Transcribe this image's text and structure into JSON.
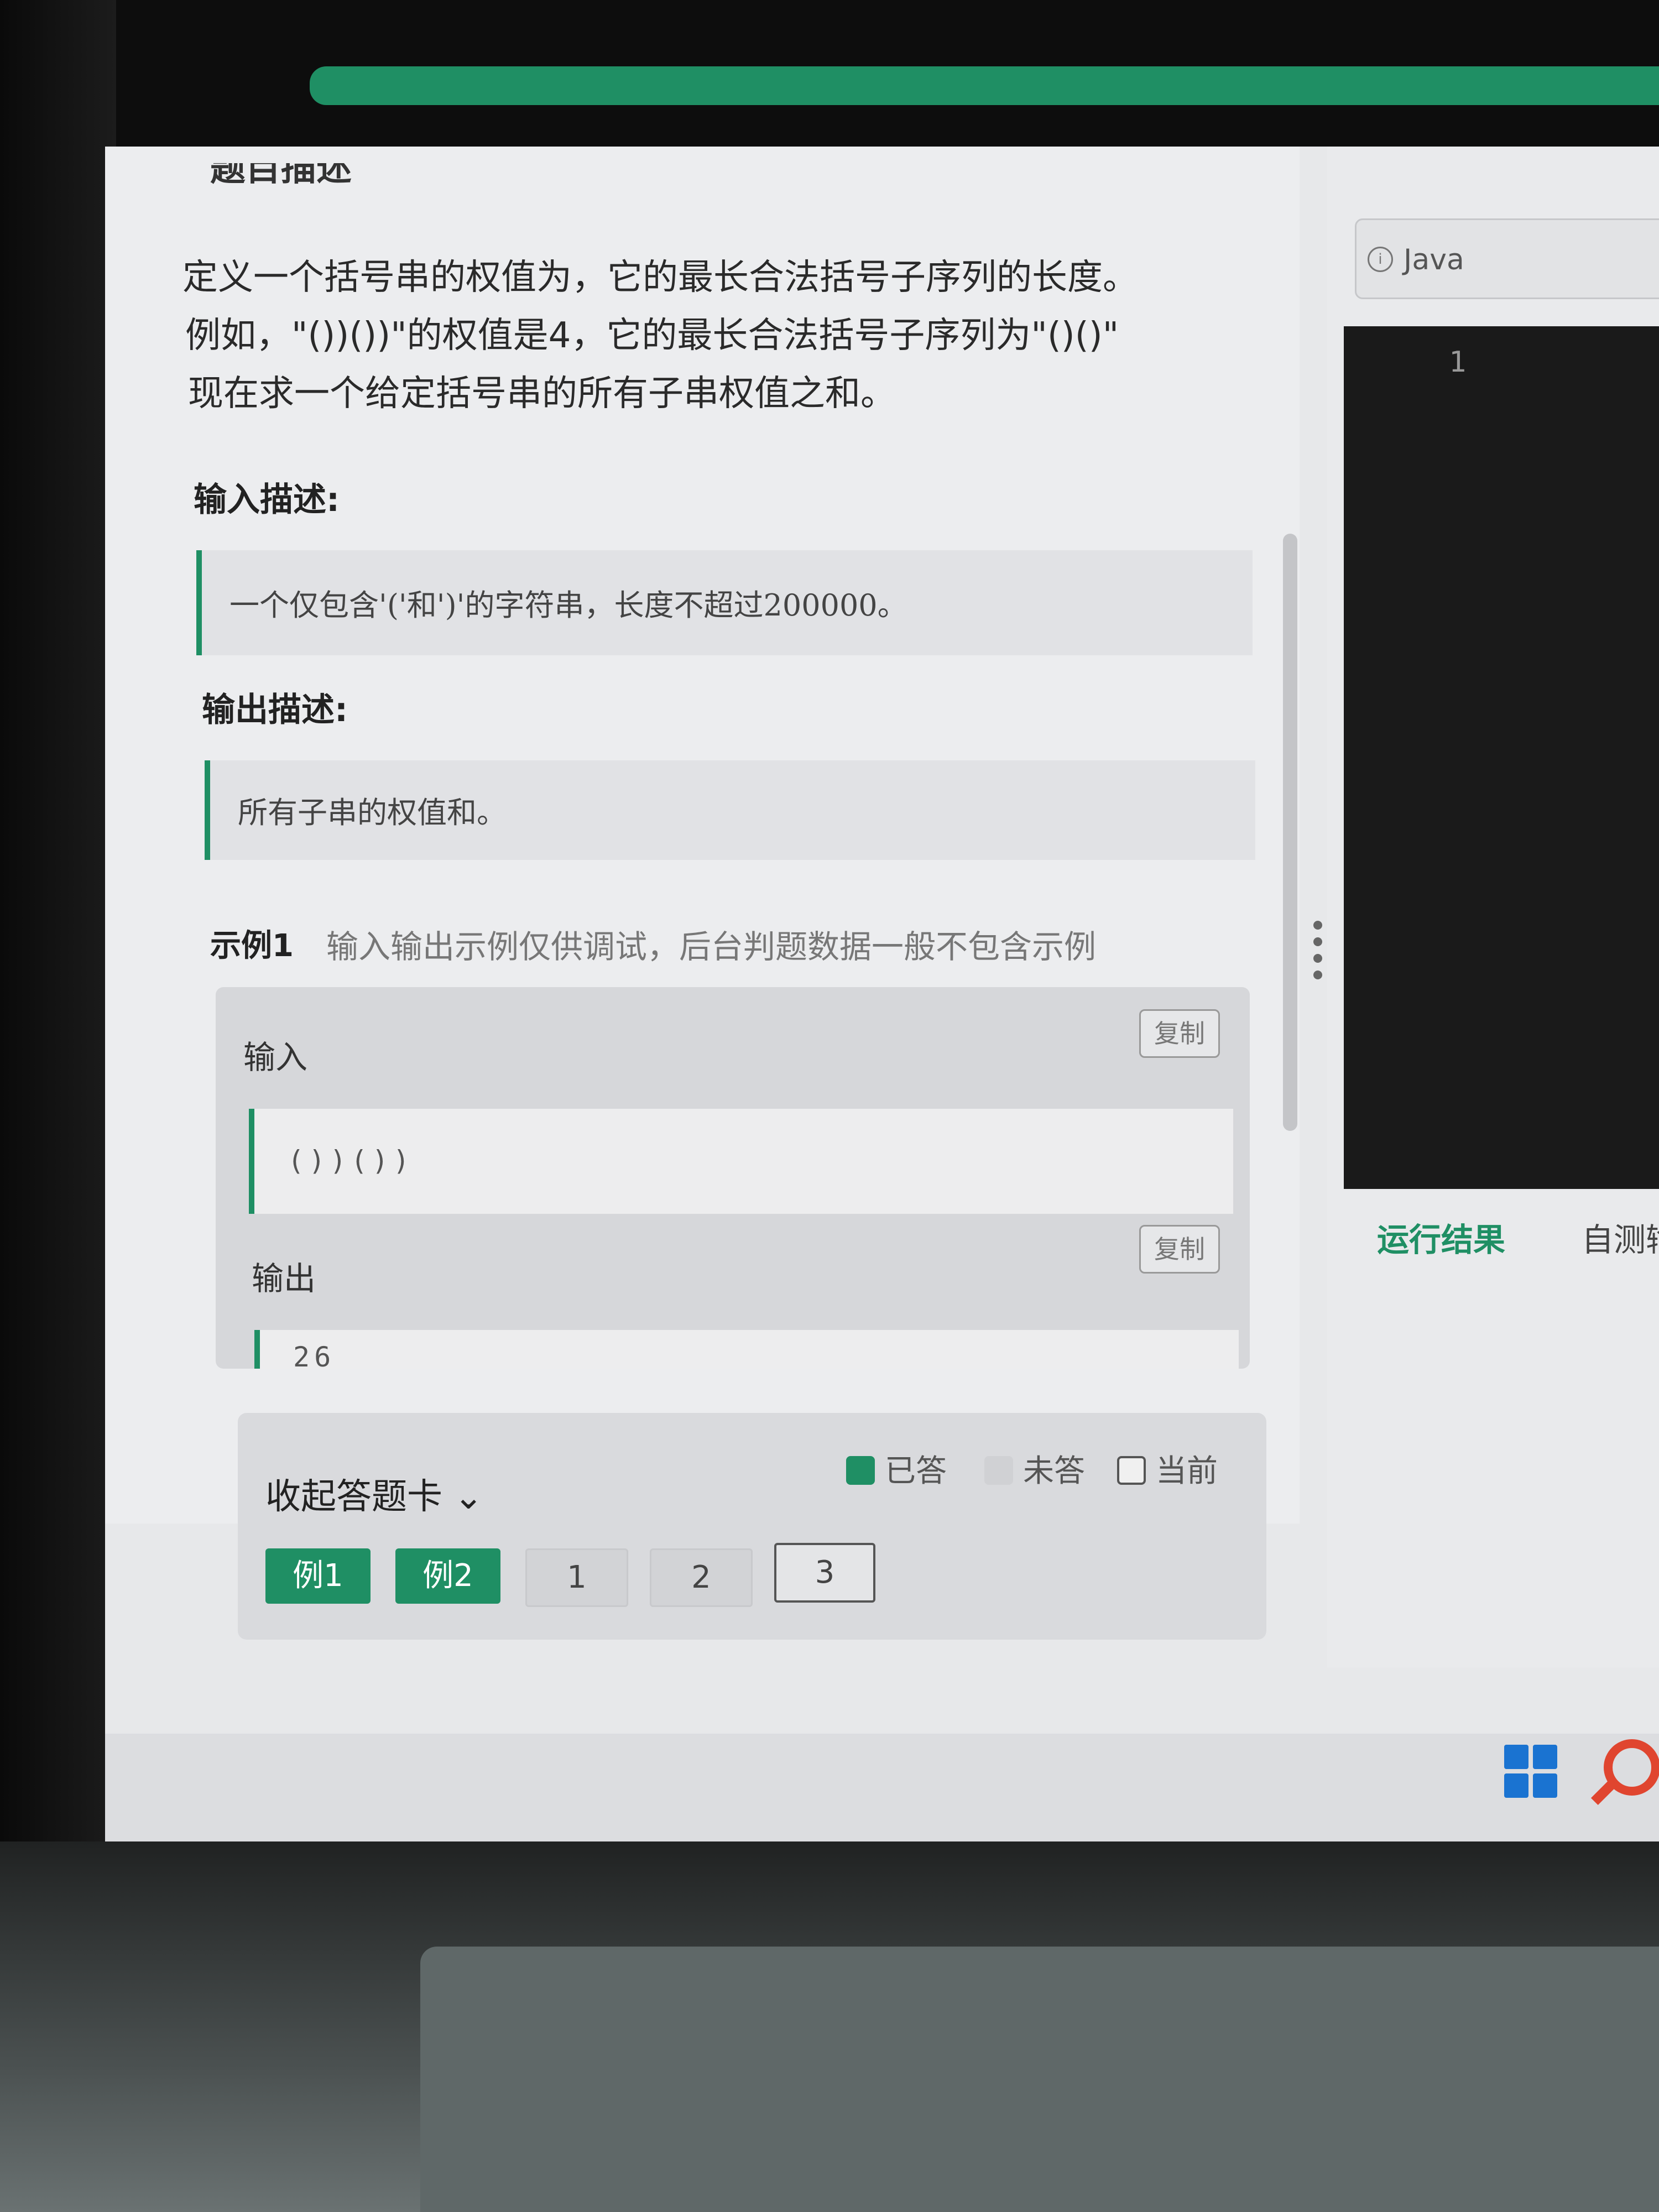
{
  "problem": {
    "description_lines": [
      "定义一个括号串的权值为，它的最长合法括号子序列的长度。",
      "例如，\"())())\"的权值是4，它的最长合法括号子序列为\"()()\"",
      "现在求一个给定括号串的所有子串权值之和。"
    ],
    "input_title": "输入描述:",
    "input_text": "一个仅包含'('和')'的字符串，长度不超过200000。",
    "output_title": "输出描述:",
    "output_text": "所有子串的权值和。"
  },
  "example": {
    "title": "示例1",
    "note": "输入输出示例仅供调试，后台判题数据一般不包含示例",
    "input_label": "输入",
    "input_value": "())())",
    "output_label": "输出",
    "output_value": "26",
    "copy_label": "复制"
  },
  "answer_card": {
    "toggle_label": "收起答题卡",
    "legend": {
      "answered": "已答",
      "unanswered": "未答",
      "current": "当前"
    },
    "questions": [
      {
        "label": "例1",
        "state": "answered"
      },
      {
        "label": "例2",
        "state": "answered"
      },
      {
        "label": "1",
        "state": "unanswered"
      },
      {
        "label": "2",
        "state": "unanswered"
      },
      {
        "label": "3",
        "state": "current"
      }
    ]
  },
  "editor": {
    "language": "Java",
    "line_number": "1"
  },
  "result_tabs": [
    "运行结果",
    "自测输"
  ],
  "colors": {
    "accent": "#1f8f64",
    "editor_bg": "#1a1a1a"
  },
  "icons": [
    "info-icon",
    "chevron-down-icon",
    "windows-start-icon",
    "search-icon"
  ]
}
